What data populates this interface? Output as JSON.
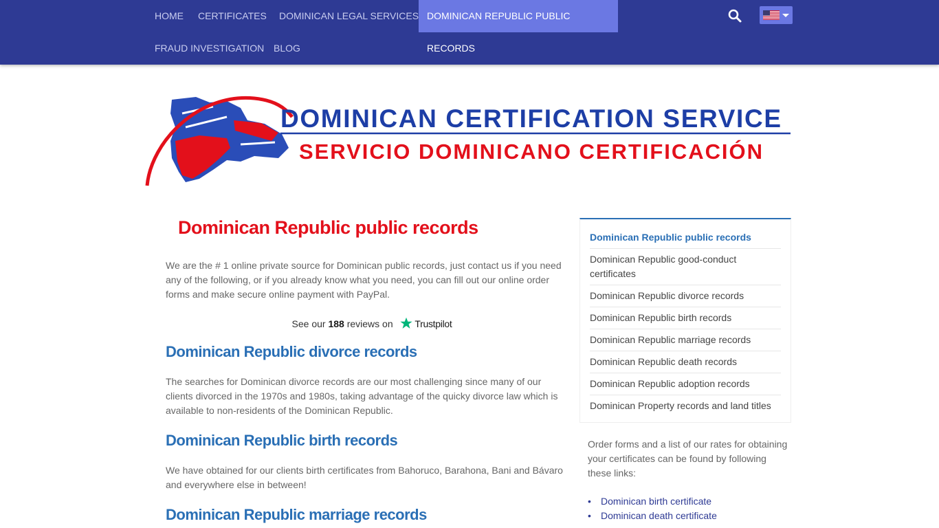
{
  "nav": {
    "items": [
      {
        "label": "HOME"
      },
      {
        "label": "CERTIFICATES"
      },
      {
        "label": "DOMINICAN LEGAL SERVICES"
      },
      {
        "label": "DOMINICAN REPUBLIC PUBLIC RECORDS",
        "active": true
      },
      {
        "label": "FRAUD INVESTIGATION"
      },
      {
        "label": "BLOG"
      }
    ],
    "search_icon": "search-icon",
    "language_flag": "us-flag-icon"
  },
  "logo": {
    "line1": "DOMINICAN CERTIFICATION SERVICE",
    "line2": "SERVICIO DOMINICANO CERTIFICACIÓN"
  },
  "main": {
    "title": "Dominican Republic public records",
    "intro": "We are the # 1 online private source for Dominican public records, just contact us if you need any of the following, or if you already know what you need, you can fill out our online order forms and make secure online payment with PayPal.",
    "trustpilot": {
      "prefix": "See our",
      "count": "188",
      "suffix": "reviews on",
      "brand": "Trustpilot"
    },
    "sections": [
      {
        "heading": "Dominican Republic divorce records",
        "text": "The searches for Dominican divorce records are our most challenging since many of our clients divorced in the 1970s and 1980s, taking advantage of the quicky divorce law which is available to non-residents of the Dominican Republic."
      },
      {
        "heading": "Dominican Republic birth records",
        "text": "We have obtained for our clients birth certificates from Bahoruco, Barahona, Bani and Bávaro and everywhere else in between!"
      },
      {
        "heading": "Dominican Republic marriage records",
        "text": ""
      }
    ]
  },
  "sidebar": {
    "links": [
      "Dominican Republic public records",
      "Dominican Republic good-conduct certificates",
      "Dominican Republic divorce records",
      "Dominican Republic birth records",
      "Dominican Republic marriage records",
      "Dominican Republic death records",
      "Dominican Republic adoption records",
      "Dominican Property records and land titles"
    ],
    "order_text": "Order forms and a list of our rates for obtaining your certificates can be found by following these links:",
    "order_links": [
      "Dominican birth certificate",
      "Dominican death certificate"
    ]
  },
  "colors": {
    "nav_bg": "#2e3a94",
    "nav_active": "#6b78e3",
    "title_red": "#e3101b",
    "heading_blue": "#2a6fb5",
    "logo_blue": "#1d3ea6"
  }
}
